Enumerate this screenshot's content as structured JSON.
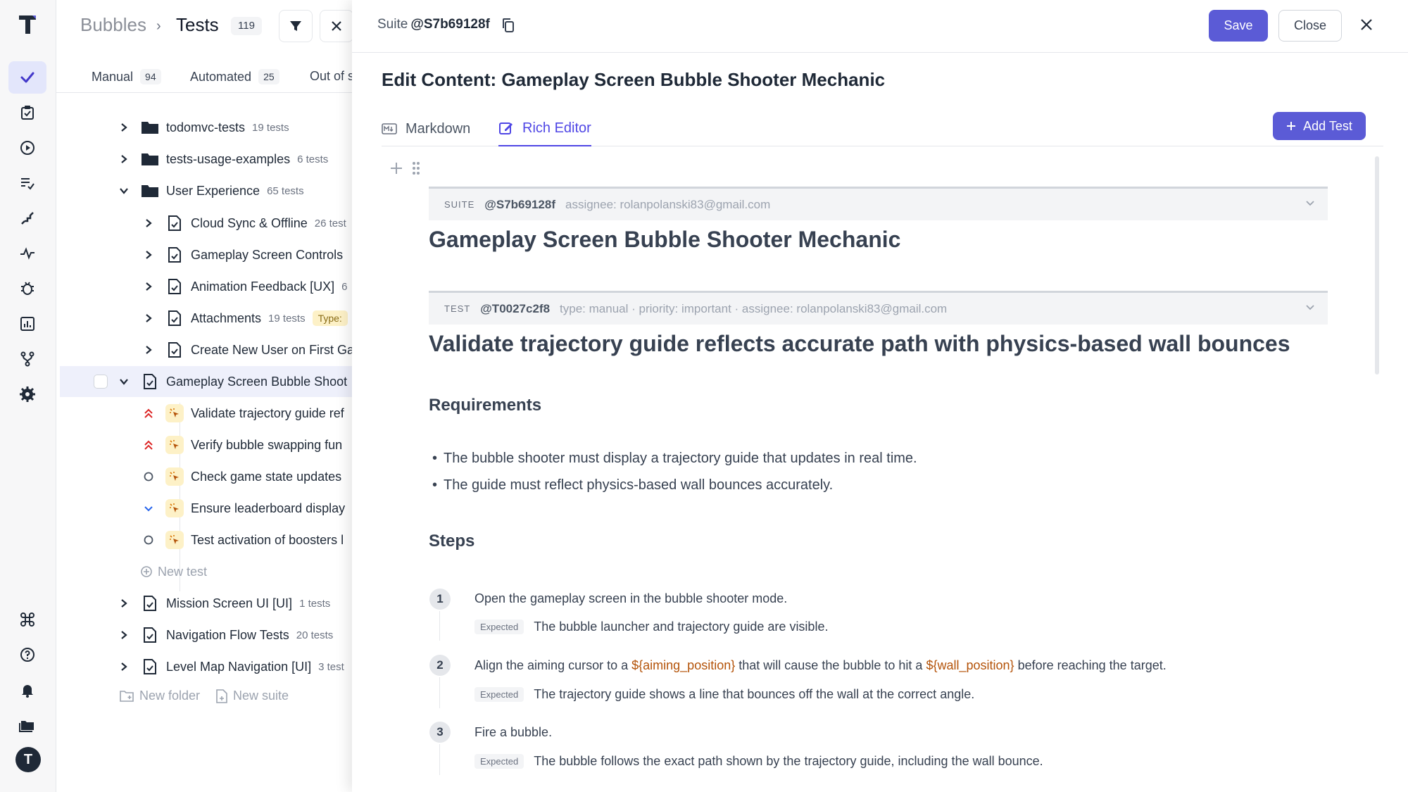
{
  "rail": {
    "logo": "T",
    "items": [
      {
        "icon": "check-icon",
        "active": true
      },
      {
        "icon": "clipboard-check-icon"
      },
      {
        "icon": "play-circle-icon"
      },
      {
        "icon": "list-check-icon"
      },
      {
        "icon": "steps-icon"
      },
      {
        "icon": "pulse-icon"
      },
      {
        "icon": "bug-icon"
      },
      {
        "icon": "bar-chart-icon"
      },
      {
        "icon": "branch-icon"
      },
      {
        "icon": "gear-icon"
      },
      {
        "icon": "command-icon"
      },
      {
        "icon": "help-icon"
      },
      {
        "icon": "bell-icon"
      },
      {
        "icon": "folders-icon"
      }
    ],
    "avatar": "T"
  },
  "tree": {
    "breadcrumb_root": "Bubbles",
    "breadcrumb_sep": "›",
    "breadcrumb_current": "Tests",
    "breadcrumb_count": "119",
    "tabs": [
      {
        "label": "Manual",
        "count": "94"
      },
      {
        "label": "Automated",
        "count": "25"
      },
      {
        "label": "Out of s",
        "count": ""
      }
    ],
    "rows": [
      {
        "name": "todomvc-tests",
        "meta": "19 tests",
        "kind": "folder"
      },
      {
        "name": "tests-usage-examples",
        "meta": "6 tests",
        "kind": "folder"
      },
      {
        "name": "User Experience",
        "meta": "65 tests",
        "kind": "folder"
      },
      {
        "name": "Cloud Sync & Offline",
        "meta": "26 test",
        "kind": "suite"
      },
      {
        "name": "Gameplay Screen Controls",
        "meta": "",
        "kind": "suite"
      },
      {
        "name": "Animation Feedback [UX]",
        "meta": "6",
        "kind": "suite"
      },
      {
        "name": "Attachments",
        "meta": "19 tests",
        "badge": "Type:",
        "kind": "suite"
      },
      {
        "name": "Create New User on First Ga",
        "meta": "",
        "kind": "suite"
      },
      {
        "name": "Gameplay Screen Bubble Shoot",
        "meta": "",
        "kind": "suite"
      },
      {
        "name": "Validate trajectory guide ref",
        "priority": "high"
      },
      {
        "name": "Verify bubble swapping fun",
        "priority": "high"
      },
      {
        "name": "Check game state updates",
        "priority": "normal"
      },
      {
        "name": "Ensure leaderboard display",
        "priority": "low"
      },
      {
        "name": "Test activation of boosters l",
        "priority": "normal"
      },
      {
        "name": "Mission Screen UI [UI]",
        "meta": "1 tests",
        "kind": "suite"
      },
      {
        "name": "Navigation Flow Tests",
        "meta": "20 tests",
        "kind": "suite"
      },
      {
        "name": "Level Map Navigation [UI]",
        "meta": "3 test",
        "kind": "suite"
      }
    ],
    "new_test": "New test",
    "new_folder": "New folder",
    "new_suite": "New suite"
  },
  "editor": {
    "suite_label": "Suite",
    "suite_id": "@S7b69128f",
    "save": "Save",
    "close": "Close",
    "title": "Edit Content: Gameplay Screen Bubble Shooter Mechanic",
    "tab_markdown": "Markdown",
    "tab_rich": "Rich Editor",
    "add_test": "Add Test",
    "suite_meta": {
      "kind": "SUITE",
      "id": "@S7b69128f",
      "info": "assignee: rolanpolanski83@gmail.com"
    },
    "suite_heading": "Gameplay Screen Bubble Shooter Mechanic",
    "test_meta": {
      "kind": "TEST",
      "id": "@T0027c2f8",
      "info": "type: manual · priority: important · assignee: rolanpolanski83@gmail.com"
    },
    "test_heading": "Validate trajectory guide reflects accurate path with physics-based wall bounces",
    "requirements_heading": "Requirements",
    "requirements": [
      "The bubble shooter must display a trajectory guide that updates in real time.",
      "The guide must reflect physics-based wall bounces accurately."
    ],
    "steps_heading": "Steps",
    "expected_label": "Expected",
    "steps": [
      {
        "num": "1",
        "text": "Open the gameplay screen in the bubble shooter mode.",
        "expected": "The bubble launcher and trajectory guide are visible."
      },
      {
        "num": "2",
        "text_a": "Align the aiming cursor to a",
        "var_a": "${aiming_position}",
        "text_b": "that will cause the bubble to hit a",
        "var_b": "${wall_position}",
        "text_c": "before reaching the target.",
        "expected": "The trajectory guide shows a line that bounces off the wall at the correct angle."
      },
      {
        "num": "3",
        "text": "Fire a bubble.",
        "expected": "The bubble follows the exact path shown by the trajectory guide, including the wall bounce."
      }
    ]
  }
}
